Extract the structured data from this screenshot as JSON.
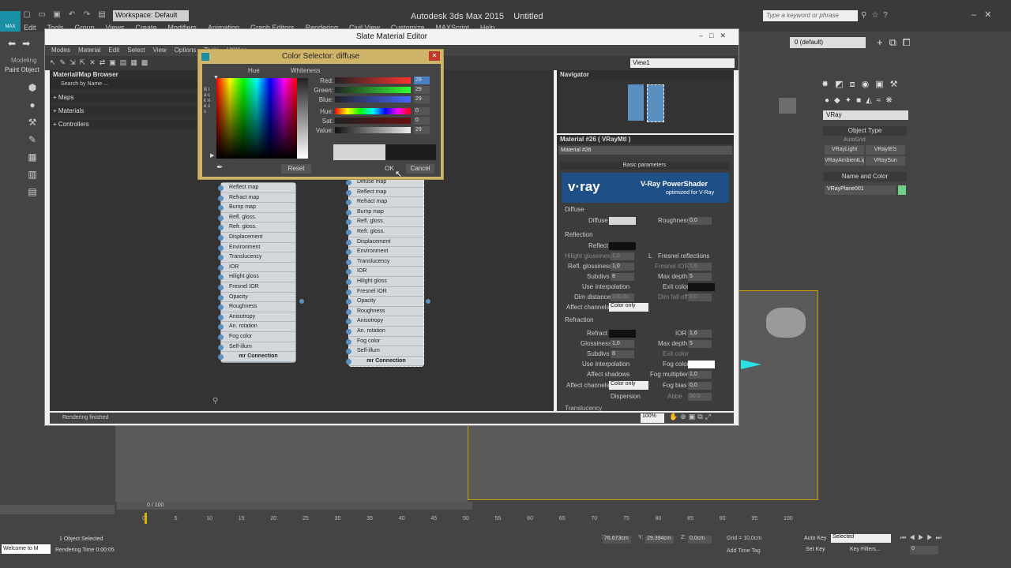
{
  "app": {
    "workspace": "Workspace: Default",
    "title": "Autodesk 3ds Max 2015",
    "file": "Untitled",
    "search_placeholder": "Type a keyword or phrase",
    "logo": "MAX",
    "menu": [
      "Edit",
      "Tools",
      "Group",
      "Views",
      "Create",
      "Modifiers",
      "Animation",
      "Graph Editors",
      "Rendering",
      "Civil View",
      "Customize",
      "MAXScript",
      "Help"
    ]
  },
  "toolbar_right": {
    "layer": "0 (default)"
  },
  "side_tabs": {
    "modeling": "Modeling",
    "paint": "Paint Object"
  },
  "sme": {
    "title": "Slate Material Editor",
    "menu": [
      "Modes",
      "Material",
      "Edit",
      "Select",
      "View",
      "Options",
      "Tools",
      "Utilities"
    ],
    "view": "View1",
    "browser": {
      "title": "Material/Map Browser",
      "search": "Search by Name ...",
      "groups": [
        "+ Maps",
        "+ Materials",
        "+ Controllers"
      ]
    },
    "nodes": {
      "left_slots": [
        "Reflect map",
        "Refract map",
        "Bump map",
        "Refl. gloss.",
        "Refr. gloss.",
        "Displacement",
        "Environment",
        "Translucency",
        "IOR",
        "Hilight gloss",
        "Fresnel IOR",
        "Roughness",
        "Anisotropy",
        "An. rotation",
        "Fog color",
        "Self-illum"
      ],
      "right_slots": [
        "Reflect map",
        "Refract map",
        "Bump map",
        "Refl. gloss.",
        "Refr. gloss.",
        "Displacement",
        "Environment",
        "Translucency",
        "IOR",
        "Hilight gloss",
        "Fresnel IOR",
        "Opacity",
        "Roughness",
        "Anisotropy",
        "An. rotation",
        "Fog color",
        "Self-illum"
      ],
      "left_extra": "Opacity",
      "footer": "mr Connection",
      "top_partial": "Diffuse map"
    },
    "navigator": "Navigator",
    "material": {
      "header": "Material #26  ( VRayMtl )",
      "name": "Material #26",
      "section": "Basic parameters",
      "banner_brand": "v·ray",
      "banner_title": "V-Ray PowerShader",
      "banner_sub": "optimized for V-Ray",
      "diffuse_group": "Diffuse",
      "diffuse": "Diffuse",
      "roughness": "Roughness",
      "roughness_val": "0,0",
      "reflection_group": "Reflection",
      "reflect": "Reflect",
      "hilight": "Hilight glossiness",
      "hilight_val": "1,0",
      "lock": "L",
      "fresnel": "Fresnel reflections",
      "refl_gloss": "Refl. glossiness",
      "refl_gloss_val": "1,0",
      "fresnel_ior": "Fresnel IOR",
      "fresnel_ior_val": "1,6",
      "subdivs": "Subdivs",
      "subdivs_val": "8",
      "max_depth": "Max depth",
      "max_depth_val": "5",
      "use_interp": "Use interpolation",
      "exit_color": "Exit color",
      "dim_dist": "Dim distance",
      "dim_dist_val": "100,0c",
      "dim_falloff": "Dim fall off",
      "dim_falloff_val": "0,0",
      "affect_ch": "Affect channels",
      "affect_val": "Color only",
      "refraction_group": "Refraction",
      "refract": "Refract",
      "ior": "IOR",
      "ior_val": "1,6",
      "gloss": "Glossiness",
      "gloss_val": "1,0",
      "max_depth2_val": "5",
      "subdivs2_val": "8",
      "exit_color2": "Exit color",
      "use_interp2": "Use interpolation",
      "fog_color": "Fog color",
      "affect_shadows": "Affect shadows",
      "fog_mult": "Fog multiplier",
      "fog_mult_val": "1,0",
      "affect_ch2": "Affect channels",
      "affect_val2": "Color only",
      "fog_bias": "Fog bias",
      "fog_bias_val": "0,0",
      "dispersion": "Dispersion",
      "abbe": "Abbe",
      "abbe_val": "50,0",
      "translucency": "Translucency"
    },
    "status": "Rendering finished",
    "zoom": "100%"
  },
  "color_selector": {
    "title": "Color Selector: diffuse",
    "hue": "Hue",
    "whiteness": "Whiteness",
    "blackness": "B l a c k n e s s",
    "labels": [
      "Red:",
      "Green:",
      "Blue:",
      "Hue:",
      "Sat:",
      "Value:"
    ],
    "values": [
      "29",
      "29",
      "29",
      "0",
      "0",
      "29"
    ],
    "reset": "Reset",
    "ok": "OK",
    "cancel": "Cancel"
  },
  "create_panel": {
    "renderer": "VRay",
    "object_type": "Object Type",
    "autogrid": "AutoGrid",
    "buttons": [
      "VRayLight",
      "VRayIES",
      "VRayAmbientLig",
      "VRaySun"
    ],
    "name_color": "Name and Color",
    "name": "VRayPlane001"
  },
  "timeline": {
    "frame": "0 / 100",
    "ticks": [
      "0",
      "5",
      "10",
      "15",
      "20",
      "25",
      "30",
      "35",
      "40",
      "45",
      "50",
      "55",
      "60",
      "65",
      "70",
      "75",
      "80",
      "85",
      "90",
      "95",
      "100"
    ]
  },
  "statusline": {
    "selected": "1 Object Selected",
    "render_time": "Rendering Time  0:00:05",
    "welcome": "Welcome to M",
    "x_label": "X:",
    "x": "76,673cm",
    "y_label": "Y:",
    "y": "29,394cm",
    "z_label": "Z:",
    "z": "0,0cm",
    "grid": "Grid = 10,0cm",
    "add_time_tag": "Add Time Tag",
    "auto_key": "Auto Key",
    "set_key": "Set Key",
    "selected_set": "Selected",
    "key_filters": "Key Filters...",
    "frame_val": "0"
  },
  "colors": {
    "accent": "#cfb46a",
    "vray_blue": "#1e4f86",
    "node_body": "#c4ccd4",
    "swatch_gray": "#d6d6d6",
    "green_chip": "#6fd08a",
    "cyan": "#2be0e6"
  }
}
